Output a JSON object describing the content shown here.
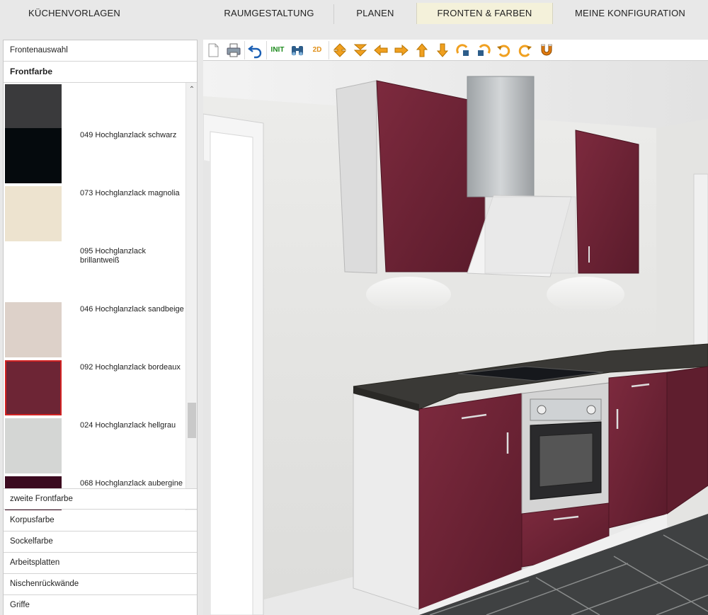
{
  "topnav": {
    "items": [
      {
        "label": "KÜCHENVORLAGEN"
      },
      {
        "label": "RAUMGESTALTUNG"
      },
      {
        "label": "PLANEN"
      },
      {
        "label": "FRONTEN & FARBEN"
      },
      {
        "label": "MEINE KONFIGURATION"
      }
    ],
    "active": "FRONTEN & FARBEN"
  },
  "leftpanel": {
    "frontenauswahl": "Frontenauswahl",
    "frontfarbe": "Frontfarbe",
    "swatches": [
      {
        "label": "",
        "color": "#3a3a3c"
      },
      {
        "label": "049 Hochglanzlack schwarz",
        "color": "#050a0d"
      },
      {
        "label": "073 Hochglanzlack magnolia",
        "color": "#ede3cf"
      },
      {
        "label": "095 Hochglanzlack brillantweiß",
        "color": "#ffffff"
      },
      {
        "label": "046 Hochglanzlack sandbeige",
        "color": "#ddd1c9"
      },
      {
        "label": "092 Hochglanzlack bordeaux",
        "color": "#6d2535",
        "selected": true
      },
      {
        "label": "024 Hochglanzlack hellgrau",
        "color": "#d4d6d4"
      },
      {
        "label": "068 Hochglanzlack aubergine",
        "color": "#3b0a1f"
      }
    ],
    "sections": [
      {
        "label": "zweite Frontfarbe"
      },
      {
        "label": "Korpusfarbe"
      },
      {
        "label": "Sockelfarbe"
      },
      {
        "label": "Arbeitsplatten"
      },
      {
        "label": "Nischenrückwände"
      },
      {
        "label": "Griffe"
      }
    ]
  },
  "toolbar": {
    "buttons": [
      "new-document-icon",
      "print-icon",
      "undo-icon",
      "init-button",
      "binoculars-icon",
      "2d-view-button",
      "move-back-icon",
      "move-forward-icon",
      "arrow-left-icon",
      "arrow-right-icon",
      "arrow-up-icon",
      "arrow-down-icon",
      "rotate-left-icon",
      "rotate-right-icon",
      "undo-rotate-icon",
      "redo-rotate-icon",
      "magnet-icon"
    ],
    "init_label": "INIT",
    "view2d_label": "2D"
  },
  "colors": {
    "bordeaux": "#6d2535",
    "accent_orange": "#f0a020",
    "active_tab": "#f4f1da"
  }
}
